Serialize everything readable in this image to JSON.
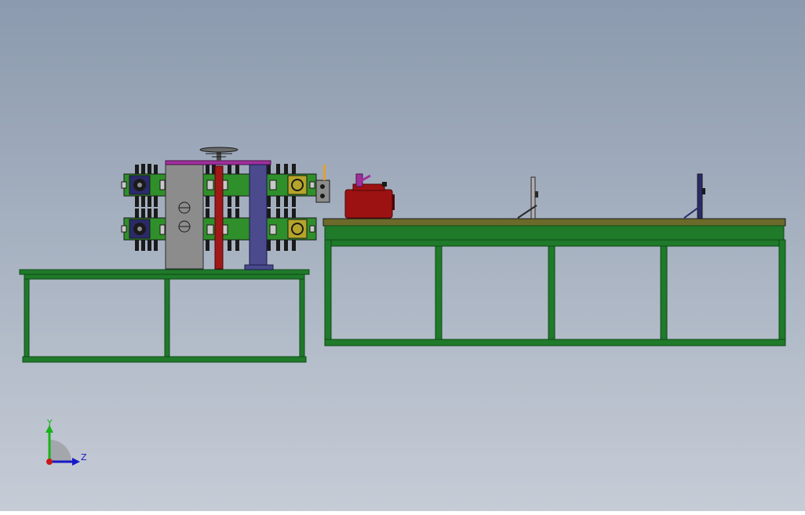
{
  "viewport": {
    "background_top": "#8b9aae",
    "background_bottom": "#c6ccd6"
  },
  "colors": {
    "frame_green": "#1f7a2a",
    "frame_dark": "#0f4a16",
    "table_top": "#6b6a2a",
    "roller_green": "#2f8f2a",
    "roller_dark": "#1a1a1a",
    "plate_grey": "#8c8c8c",
    "post_blue": "#4a4a8c",
    "shaft_red": "#a01818",
    "tank_red": "#9c1212",
    "accent_magenta": "#a0309c",
    "hub_yellow": "#b5a42a",
    "hub_navy": "#2a2a6a"
  },
  "triad": {
    "y_label": "Y",
    "z_label": "Z",
    "y_color": "#18b418",
    "z_color": "#1818c8",
    "origin_color": "#c81818"
  }
}
